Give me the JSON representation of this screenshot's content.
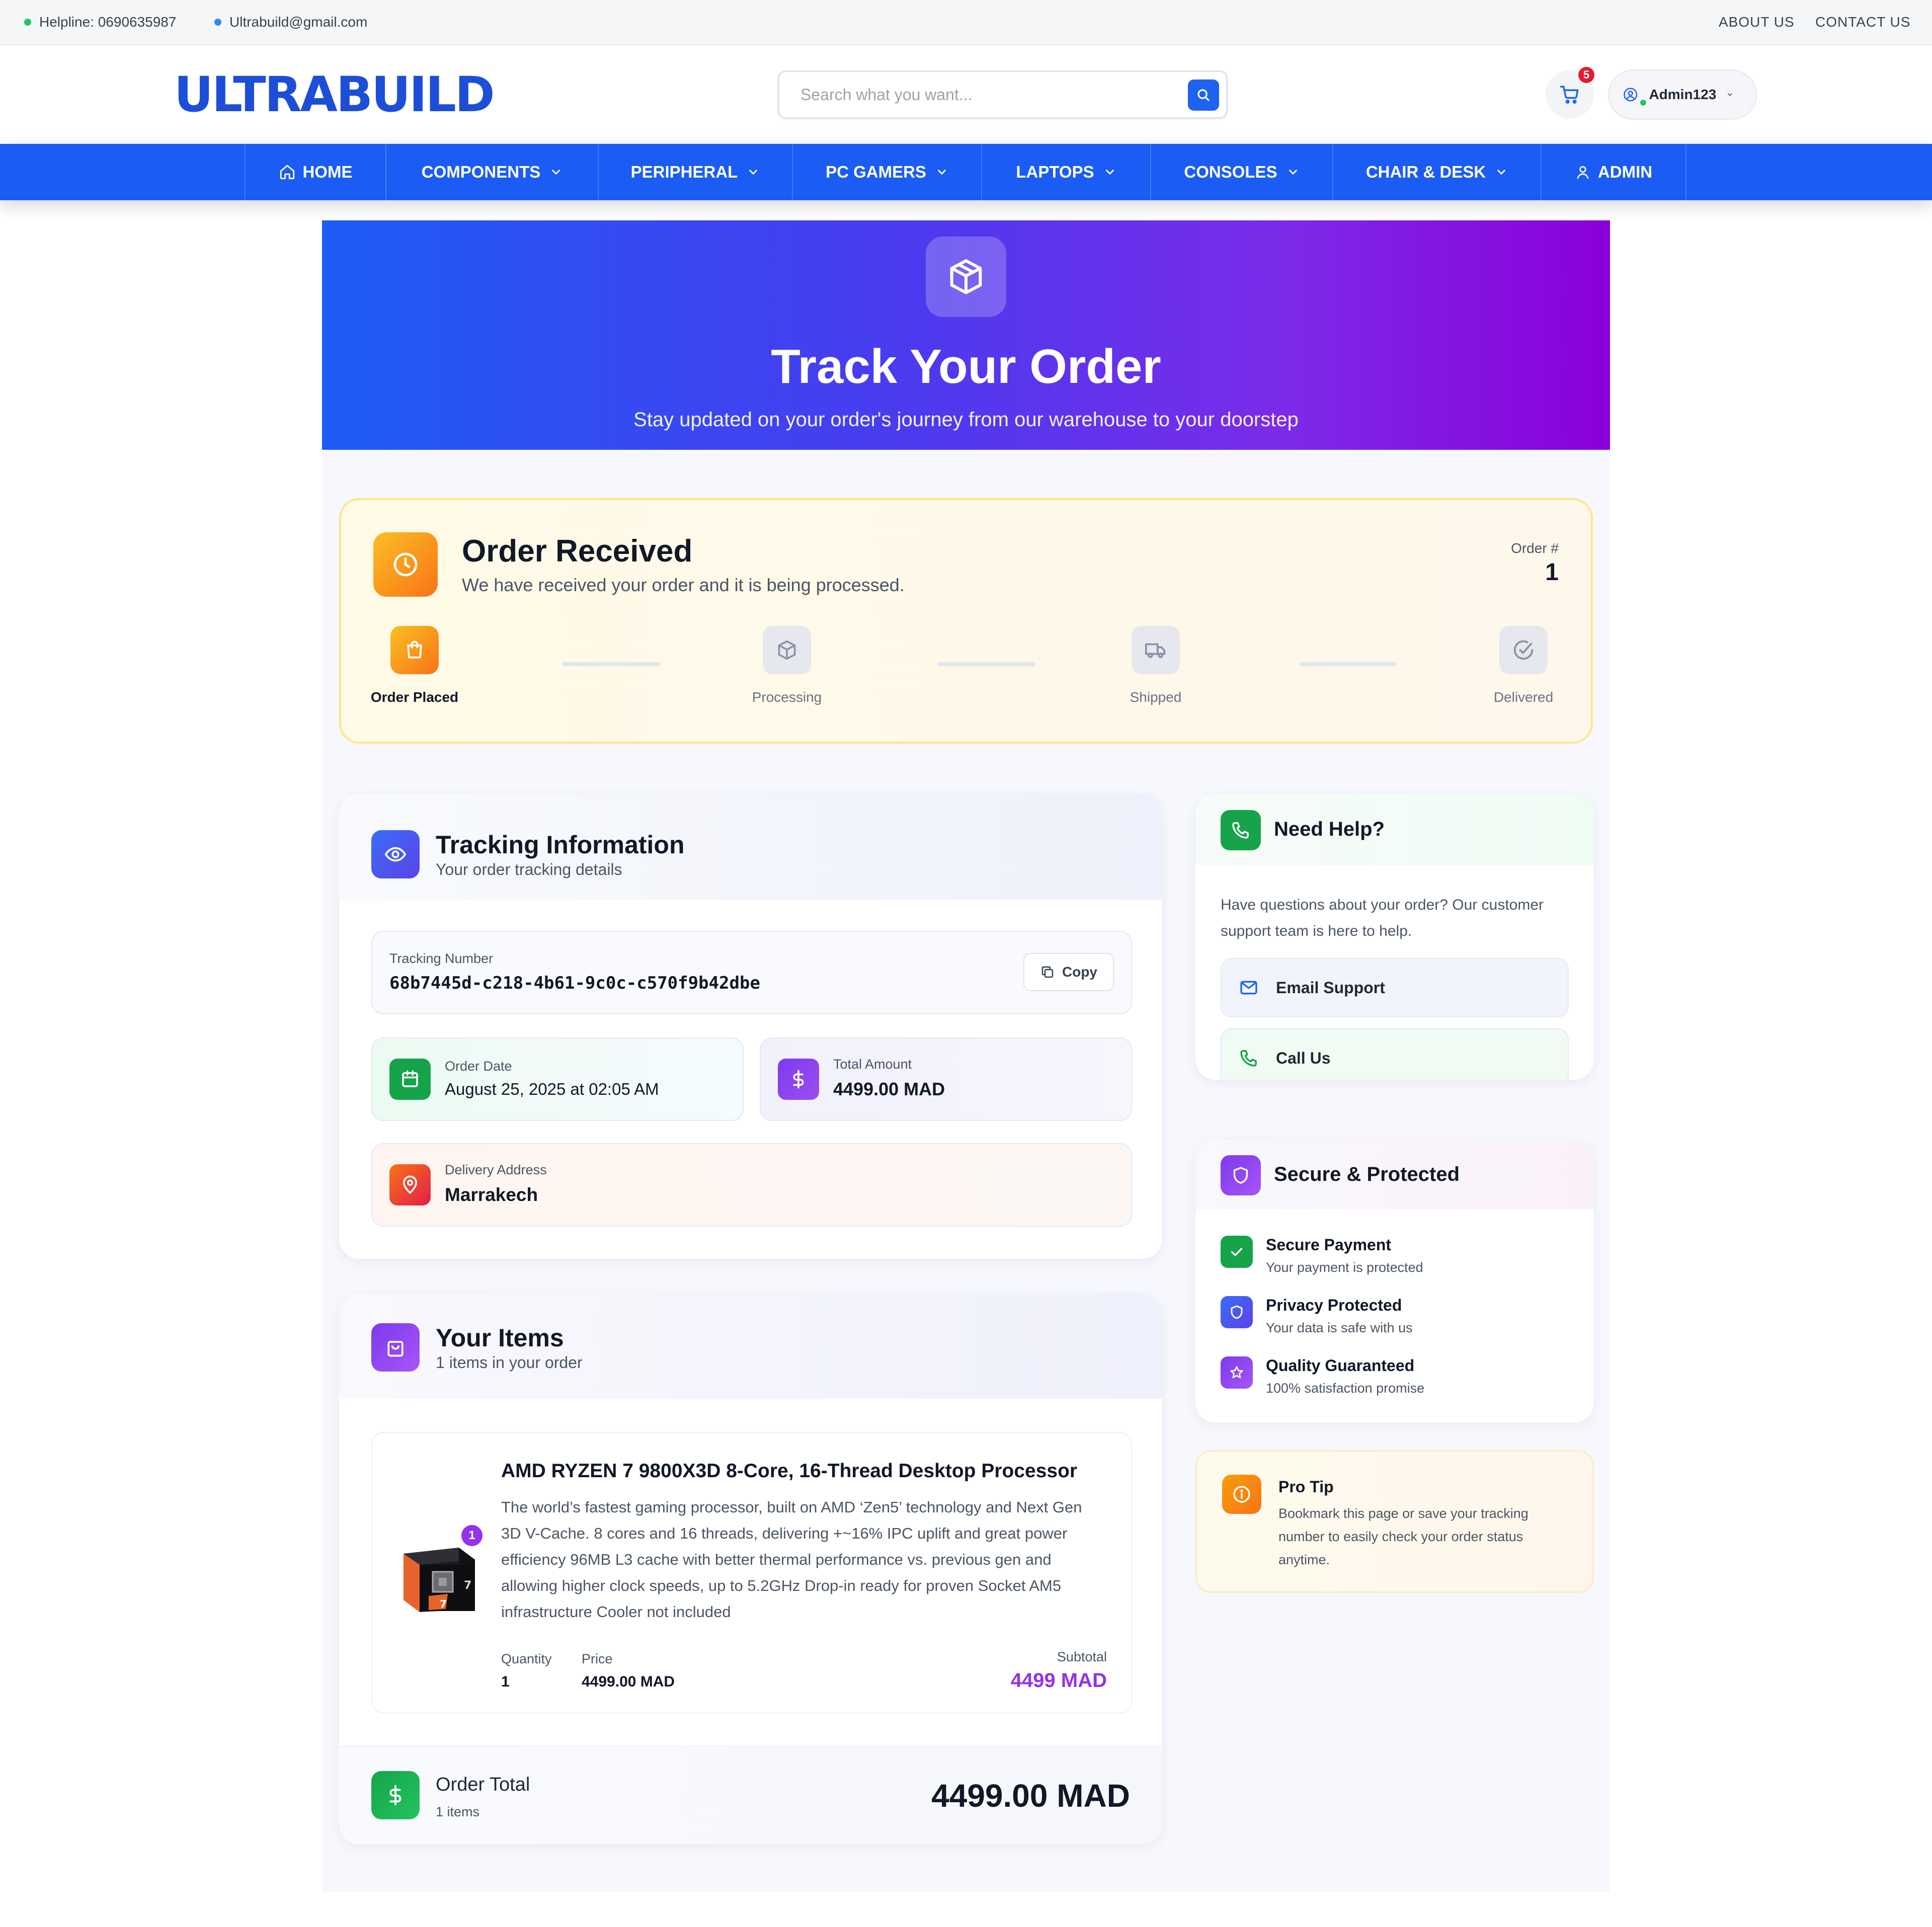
{
  "topbar": {
    "helpline": "Helpline: 0690635987",
    "email": "Ultrabuild@gmail.com",
    "links": [
      "ABOUT US",
      "CONTACT US"
    ]
  },
  "header": {
    "logo": "ULTRABUILD",
    "search_placeholder": "Search what you want...",
    "cart_count": "5",
    "username": "Admin123"
  },
  "nav": {
    "items": [
      "HOME",
      "COMPONENTS",
      "PERIPHERAL",
      "PC GAMERS",
      "LAPTOPS",
      "CONSOLES",
      "CHAIR & DESK",
      "ADMIN"
    ]
  },
  "hero": {
    "title": "Track Your Order",
    "subtitle": "Stay updated on your order's journey from our warehouse to your doorstep"
  },
  "status": {
    "title": "Order Received",
    "description": "We have received your order and it is being processed.",
    "order_label": "Order #",
    "order_number": "1",
    "steps": [
      "Order Placed",
      "Processing",
      "Shipped",
      "Delivered"
    ],
    "active_step": 0
  },
  "tracking": {
    "title": "Tracking Information",
    "subtitle": "Your order tracking details",
    "number_label": "Tracking Number",
    "number": "68b7445d-c218-4b61-9c0c-c570f9b42dbe",
    "copy_label": "Copy",
    "date_label": "Order Date",
    "date": "August 25, 2025 at 02:05 AM",
    "amount_label": "Total Amount",
    "amount": "4499.00 MAD",
    "address_label": "Delivery Address",
    "address": "Marrakech"
  },
  "items": {
    "title": "Your Items",
    "subtitle": "1 items in your order",
    "list": [
      {
        "name": "AMD RYZEN 7 9800X3D 8-Core, 16-Thread Desktop Processor",
        "desc_lines": [
          "The world’s fastest gaming processor, built on AMD ‘Zen5’ technology and Next Gen",
          "3D V-Cache. 8 cores and 16 threads, delivering +~16% IPC uplift and great power",
          "efficiency 96MB L3 cache with better thermal performance vs. previous gen and",
          "allowing higher clock speeds, up to 5.2GHz Drop-in ready for proven Socket AM5",
          "infrastructure Cooler not included"
        ],
        "badge": "1",
        "quantity_label": "Quantity",
        "quantity": "1",
        "price_label": "Price",
        "price": "4499.00 MAD",
        "subtotal_label": "Subtotal",
        "subtotal": "4499 MAD"
      }
    ],
    "total_label": "Order Total",
    "total_sub": "1 items",
    "total": "4499.00 MAD"
  },
  "help": {
    "title": "Need Help?",
    "line1": "Have questions about your order? Our customer",
    "line2": "support team is here to help.",
    "email_btn": "Email Support",
    "call_btn": "Call Us"
  },
  "secure": {
    "title": "Secure & Protected",
    "rows": [
      {
        "title": "Secure Payment",
        "desc": "Your payment is protected"
      },
      {
        "title": "Privacy Protected",
        "desc": "Your data is safe with us"
      },
      {
        "title": "Quality Guaranteed",
        "desc": "100% satisfaction promise"
      }
    ]
  },
  "tip": {
    "title": "Pro Tip",
    "lines": [
      "Bookmark this page or save your tracking",
      "number to easily check your order status",
      "anytime."
    ]
  },
  "colors": {
    "brand": "#1d4ed8",
    "nav": "#1a5cf4",
    "hero_start": "#1d5cf5",
    "hero_end": "#8b00d9",
    "accent_purple": "#9333ea",
    "status_border": "#fde68a"
  }
}
